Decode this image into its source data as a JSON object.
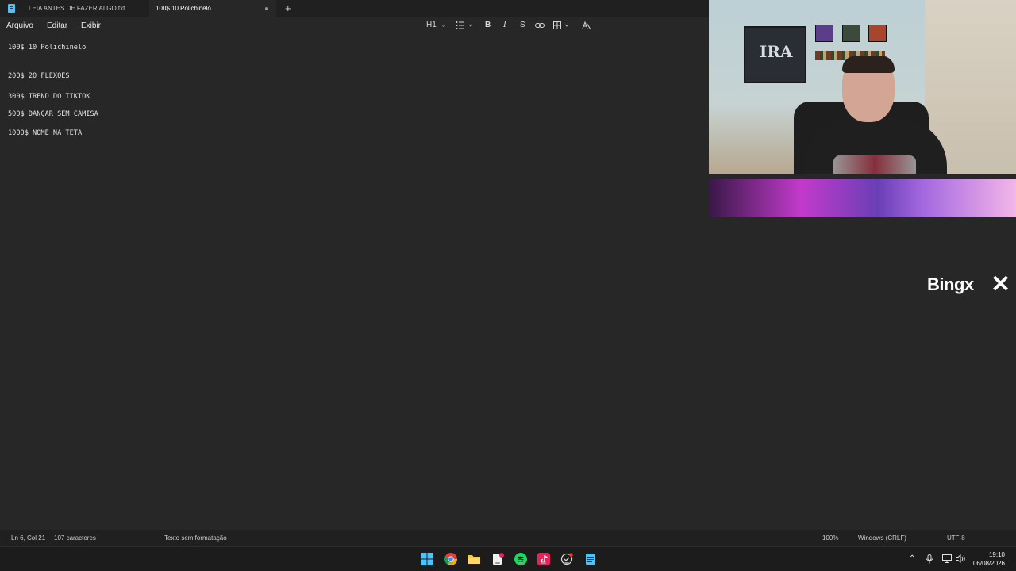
{
  "tabs": [
    {
      "label": "LEIA ANTES DE FAZER ALGO.txt",
      "active": false
    },
    {
      "label": "100$ 10 Polichinelo",
      "active": true,
      "unsaved": true
    }
  ],
  "new_tab_label": "+",
  "menu": {
    "arquivo": "Arquivo",
    "editar": "Editar",
    "exibir": "Exibir"
  },
  "toolbar": {
    "heading": "H1",
    "icons": [
      "heading-dropdown-icon",
      "list-icon",
      "bold-icon",
      "italic-icon",
      "strikethrough-icon",
      "link-icon",
      "table-icon",
      "clear-formatting-icon"
    ]
  },
  "editor": {
    "lines": [
      "100$ 10 Polichinelo",
      "",
      "200$ 20 FLEXOES",
      "300$ TREND DO TIKTOK",
      "500$ DANÇAR SEM CAMISA",
      "1000$ NOME NA TETA"
    ]
  },
  "webcam": {
    "poster_text": "IRA"
  },
  "sponsor": {
    "name": "BingX"
  },
  "status": {
    "position": "Ln 6, Col 21",
    "chars": "107 caracteres",
    "format": "Texto sem formatação",
    "zoom": "100%",
    "line_ending": "Windows (CRLF)",
    "encoding": "UTF-8"
  },
  "taskbar": {
    "apps": [
      "windows-start-icon",
      "chrome-icon",
      "file-explorer-icon",
      "notes-app-icon",
      "spotify-icon",
      "tiktok-icon",
      "recording-app-icon",
      "notepad-icon"
    ],
    "time": "19:10",
    "date": "06/08/2026"
  },
  "colors": {
    "background": "#272727",
    "tab_bar": "#202020",
    "accent": "#4fc3f7",
    "overlay_pink": "#c23acb"
  }
}
